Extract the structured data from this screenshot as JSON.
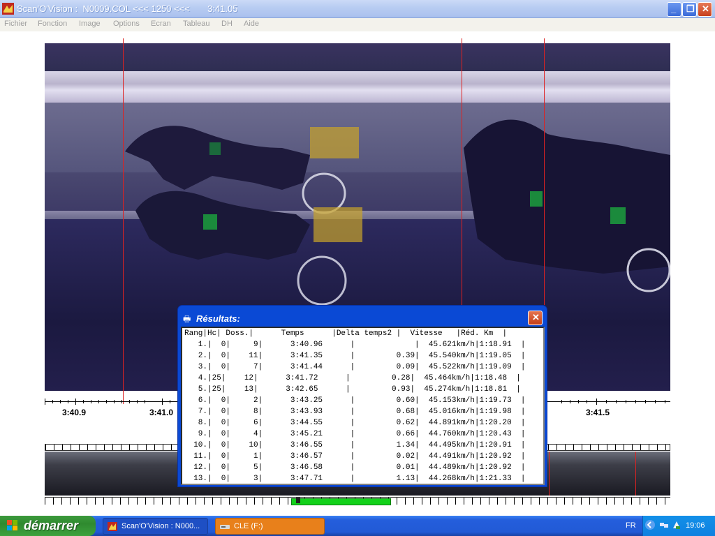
{
  "window": {
    "title": "Scan'O'Vision :  N0009.COL <<< 1250 <<<       3:41.05",
    "buttons": {
      "minimize": "_",
      "maximize": "❐",
      "close": "✕"
    }
  },
  "menu": [
    "Fichier",
    "Fonction",
    "Image",
    "Options",
    "Ecran",
    "Tableau",
    "DH",
    "Aide"
  ],
  "axis": {
    "labels": [
      "3:40.9",
      "3:41.0",
      "3:41.5"
    ]
  },
  "dialog": {
    "title": "Résultats:",
    "header": "Rang|Hc| Doss.|      Temps      |Delta temps2 |  Vitesse   |Réd. Km  |",
    "rows": [
      "   1.|  0|     9|      3:40.96      |             |  45.621km/h|1:18.91  |",
      "   2.|  0|    11|      3:41.35      |         0.39|  45.540km/h|1:19.05  |",
      "   3.|  0|     7|      3:41.44      |         0.09|  45.522km/h|1:19.09  |",
      "   4.|25|    12|      3:41.72      |         0.28|  45.464km/h|1:18.48  |",
      "   5.|25|    13|      3:42.65      |         0.93|  45.274km/h|1:18.81  |",
      "   6.|  0|     2|      3:43.25      |         0.60|  45.153km/h|1:19.73  |",
      "   7.|  0|     8|      3:43.93      |         0.68|  45.016km/h|1:19.98  |",
      "   8.|  0|     6|      3:44.55      |         0.62|  44.891km/h|1:20.20  |",
      "   9.|  0|     4|      3:45.21      |         0.66|  44.760km/h|1:20.43  |",
      "  10.|  0|    10|      3:46.55      |         1.34|  44.495km/h|1:20.91  |",
      "  11.|  0|     1|      3:46.57      |         0.02|  44.491km/h|1:20.92  |",
      "  12.|  0|     5|      3:46.58      |         0.01|  44.489km/h|1:20.92  |",
      "  13.|  0|     3|      3:47.71      |         1.13|  44.268km/h|1:21.33  |"
    ]
  },
  "taskbar": {
    "start_label": "démarrer",
    "tasks": [
      "Scan'O'Vision : N000...",
      "CLE (F:)"
    ],
    "language": "FR",
    "clock": "19:06"
  }
}
